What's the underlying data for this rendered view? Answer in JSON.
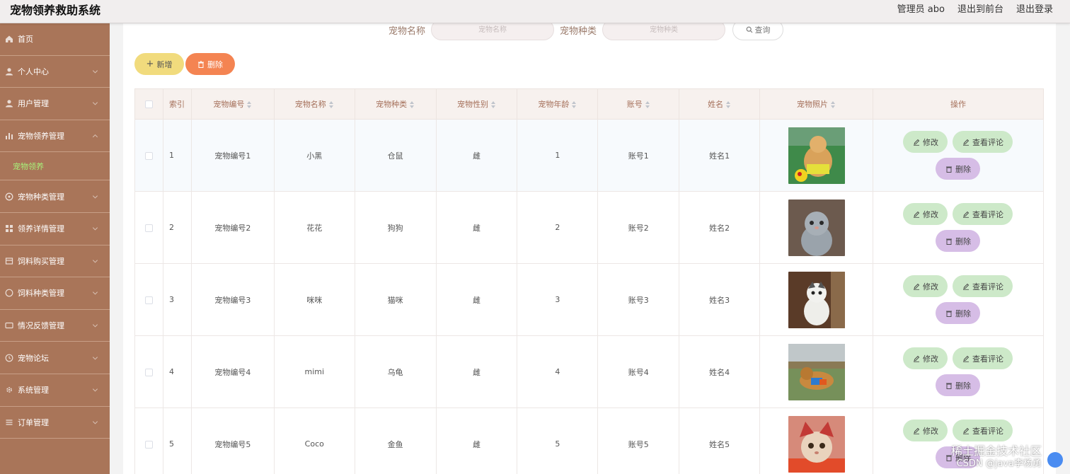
{
  "header": {
    "app_title": "宠物领养救助系统",
    "user_label": "管理员 abo",
    "to_front_label": "退出到前台",
    "logout_label": "退出登录"
  },
  "sidebar": {
    "items": [
      {
        "label": "首页",
        "icon": "home-icon"
      },
      {
        "label": "个人中心",
        "icon": "user-icon"
      },
      {
        "label": "用户管理",
        "icon": "users-icon"
      },
      {
        "label": "宠物领养管理",
        "icon": "chart-icon",
        "expanded": true
      },
      {
        "label": "宠物种类管理",
        "icon": "category-icon"
      },
      {
        "label": "领养详情管理",
        "icon": "grid-icon"
      },
      {
        "label": "饲料购买管理",
        "icon": "cart-icon"
      },
      {
        "label": "饲料种类管理",
        "icon": "list-icon"
      },
      {
        "label": "情况反馈管理",
        "icon": "feedback-icon"
      },
      {
        "label": "宠物论坛",
        "icon": "forum-icon"
      },
      {
        "label": "系统管理",
        "icon": "settings-icon"
      },
      {
        "label": "订单管理",
        "icon": "order-icon"
      }
    ],
    "active_sub": "宠物领养"
  },
  "search": {
    "name_label": "宠物名称",
    "name_placeholder": "宠物名称",
    "type_label": "宠物种类",
    "type_placeholder": "宠物种类",
    "query_label": "查询"
  },
  "toolbar": {
    "add_label": "新增",
    "delete_label": "删除"
  },
  "table": {
    "columns": [
      "索引",
      "宠物编号",
      "宠物名称",
      "宠物种类",
      "宠物性别",
      "宠物年龄",
      "账号",
      "姓名",
      "宠物照片",
      "操作"
    ],
    "rows": [
      {
        "index": "1",
        "pet_no": "宠物编号1",
        "pet_name": "小黑",
        "pet_type": "仓鼠",
        "gender": "雌",
        "age": "1",
        "account": "账号1",
        "name": "姓名1",
        "photo": "dog-with-ball"
      },
      {
        "index": "2",
        "pet_no": "宠物编号2",
        "pet_name": "花花",
        "pet_type": "狗狗",
        "gender": "雌",
        "age": "2",
        "account": "账号2",
        "name": "姓名2",
        "photo": "grey-kitten"
      },
      {
        "index": "3",
        "pet_no": "宠物编号3",
        "pet_name": "咪咪",
        "pet_type": "猫咪",
        "gender": "雌",
        "age": "3",
        "account": "账号3",
        "name": "姓名3",
        "photo": "white-cat"
      },
      {
        "index": "4",
        "pet_no": "宠物编号4",
        "pet_name": "mimi",
        "pet_type": "乌龟",
        "gender": "雌",
        "age": "4",
        "account": "账号4",
        "name": "姓名4",
        "photo": "dog-running"
      },
      {
        "index": "5",
        "pet_no": "宠物编号5",
        "pet_name": "Coco",
        "pet_type": "金鱼",
        "gender": "雌",
        "age": "5",
        "account": "账号5",
        "name": "姓名5",
        "photo": "cat-in-hat"
      }
    ],
    "op_edit": "修改",
    "op_comment": "查看评论",
    "op_delete": "删除"
  },
  "watermark": {
    "line1": "稀土掘金技术社区",
    "line2": "CSDN @java李杨勇"
  },
  "colors": {
    "sidebar": "#a97559",
    "add_button": "#f1db7d",
    "delete_button": "#f48452",
    "edit_button": "#cde9c9",
    "remove_button": "#d6bde6",
    "active_submenu": "#a8f07a"
  }
}
